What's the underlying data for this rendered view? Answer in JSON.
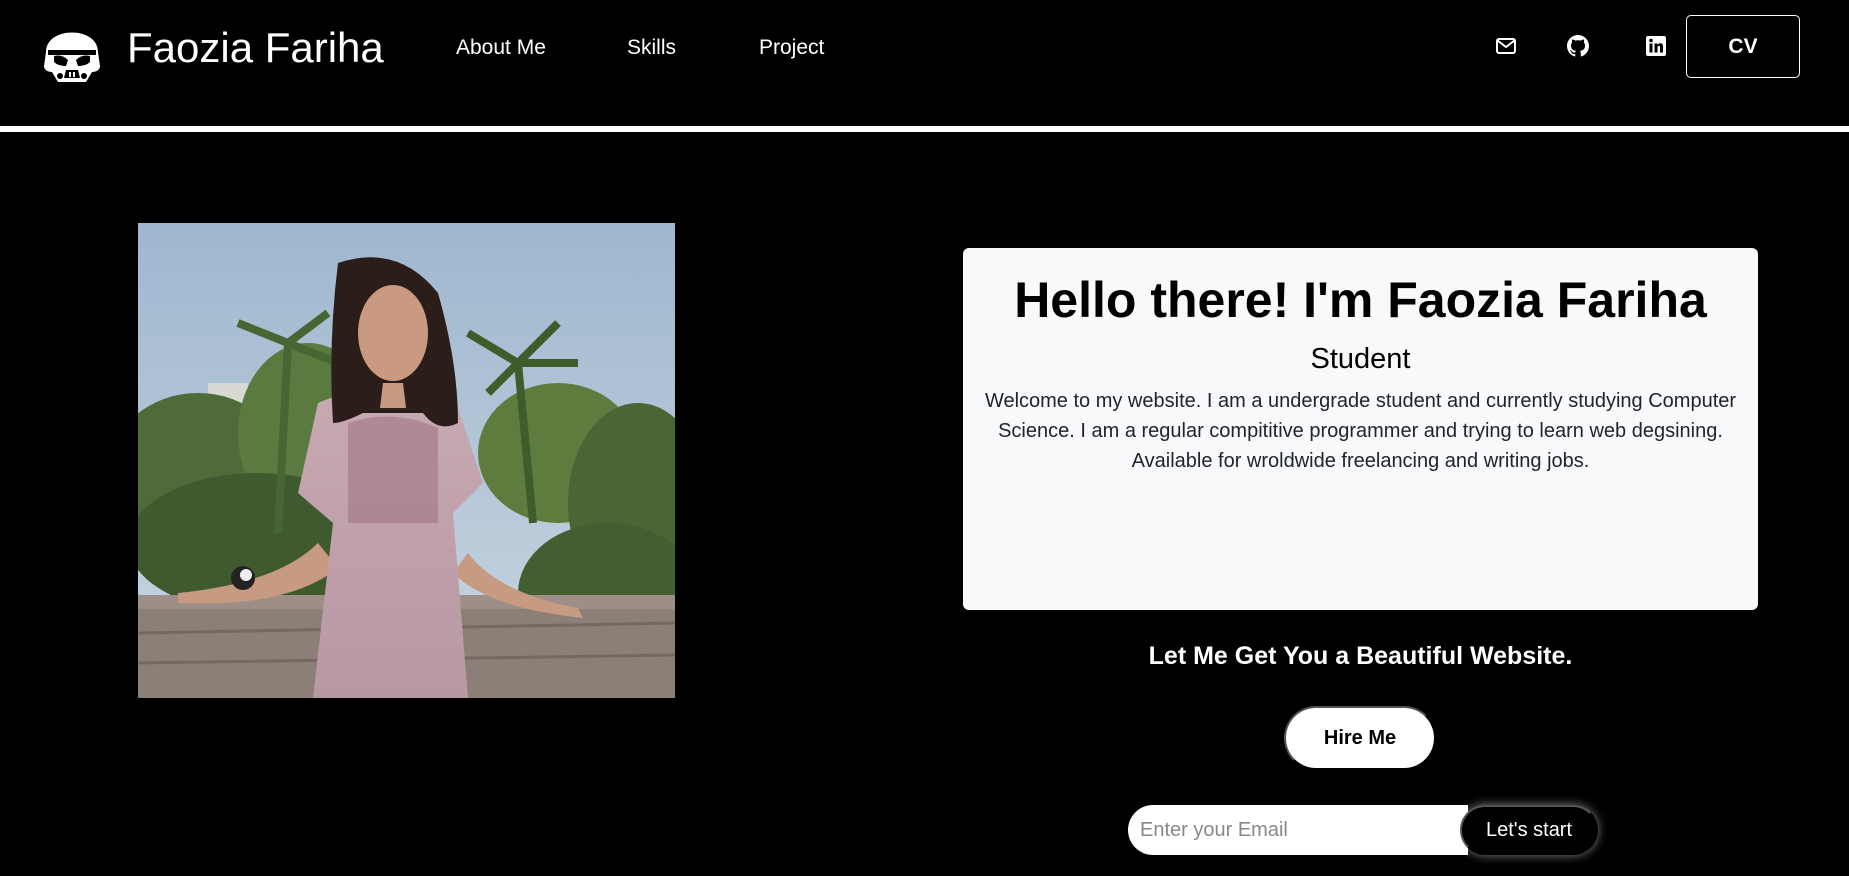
{
  "header": {
    "brand_name": "Faozia Fariha",
    "logo_icon": "stormtrooper-helmet-icon",
    "nav": [
      {
        "label": "About Me"
      },
      {
        "label": "Skills"
      },
      {
        "label": "Project"
      }
    ],
    "social": [
      {
        "icon": "mail-icon"
      },
      {
        "icon": "github-icon"
      },
      {
        "icon": "linkedin-icon"
      }
    ],
    "cv_label": "CV"
  },
  "hero": {
    "portrait_alt": "portrait photo",
    "title": "Hello there! I'm Faozia Fariha",
    "subtitle": "Student",
    "description": "Welcome to my website. I am a undergrade student and currently studying Computer Science. I am a regular compititive programmer and trying to learn web degsining. Available for wroldwide freelancing and writing jobs.",
    "tagline": "Let Me Get You a Beautiful Website.",
    "hire_label": "Hire Me",
    "email_placeholder": "Enter your Email",
    "start_label": "Let's start"
  },
  "colors": {
    "background": "#000000",
    "card": "#f8f9fa",
    "text_light": "#ffffff",
    "text_dark": "#212529"
  }
}
